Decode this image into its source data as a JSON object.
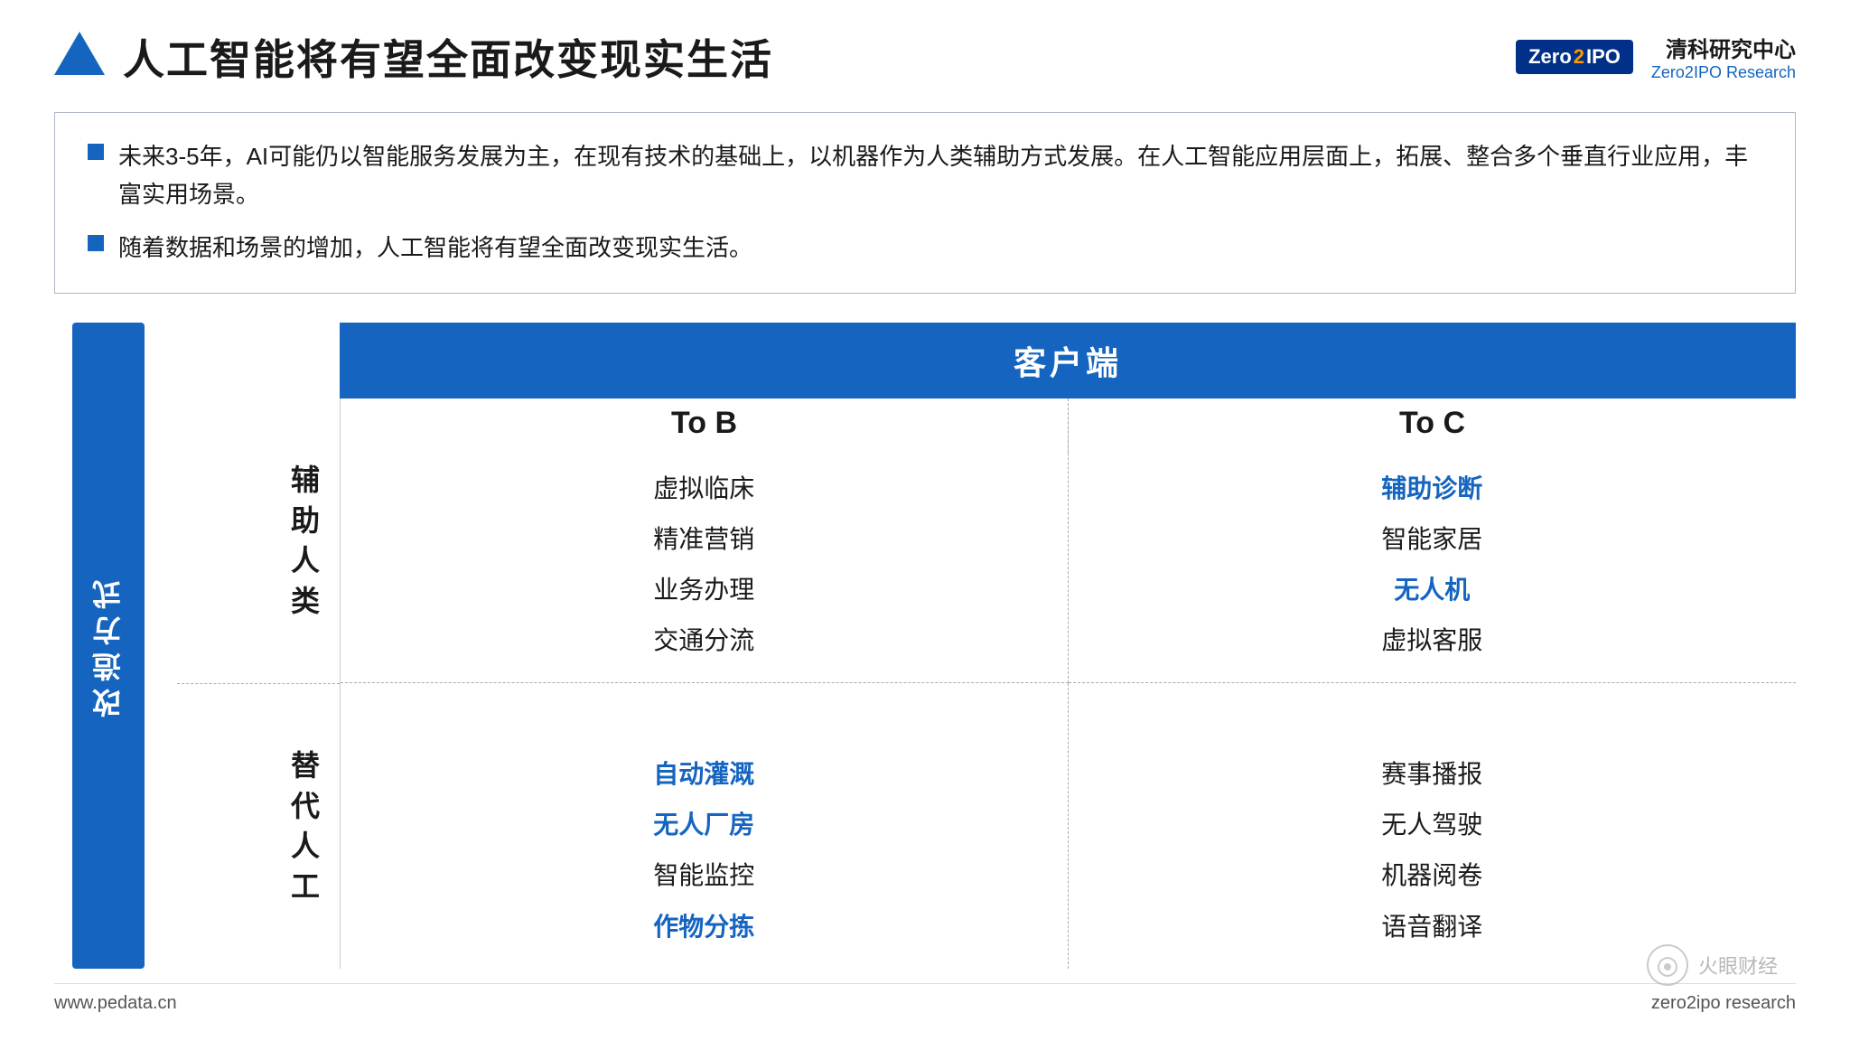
{
  "header": {
    "title": "人工智能将有望全面改变现实生活",
    "brand_cn": "清科研究中心",
    "brand_en": "Zero2IPO Research",
    "logo_zero": "Zero",
    "logo_2": "2",
    "logo_ipo": "IPO"
  },
  "bullets": [
    {
      "text": "未来3-5年，AI可能仍以智能服务发展为主，在现有技术的基础上，以机器作为人类辅助方式发展。在人工智能应用层面上，拓展、整合多个垂直行业应用，丰富实用场景。"
    },
    {
      "text": "随着数据和场景的增加，人工智能将有望全面改变现实生活。"
    }
  ],
  "diagram": {
    "left_label": "改造方式",
    "customer_header": "客户端",
    "col_b": "To  B",
    "col_c": "To  C",
    "row_top_label": "辅\n助\n人\n类",
    "row_bottom_label": "替\n代\n人\n工",
    "quadrant_tl": [
      "虚拟临床",
      "精准营销",
      "业务办理",
      "交通分流"
    ],
    "quadrant_tl_colors": [
      "normal",
      "normal",
      "normal",
      "normal"
    ],
    "quadrant_tr": [
      "辅助诊断",
      "智能家居",
      "无人机",
      "虚拟客服"
    ],
    "quadrant_tr_colors": [
      "blue",
      "normal",
      "blue",
      "normal"
    ],
    "quadrant_bl": [
      "自动灌溉",
      "无人厂房",
      "智能监控",
      "作物分拣"
    ],
    "quadrant_bl_colors": [
      "blue",
      "blue",
      "normal",
      "blue"
    ],
    "quadrant_br": [
      "赛事播报",
      "无人驾驶",
      "机器阅卷",
      "语音翻译"
    ],
    "quadrant_br_colors": [
      "normal",
      "normal",
      "normal",
      "normal"
    ]
  },
  "footer": {
    "left": "www.pedata.cn",
    "right": "zero2ipo research"
  },
  "watermark": "火眼财经"
}
